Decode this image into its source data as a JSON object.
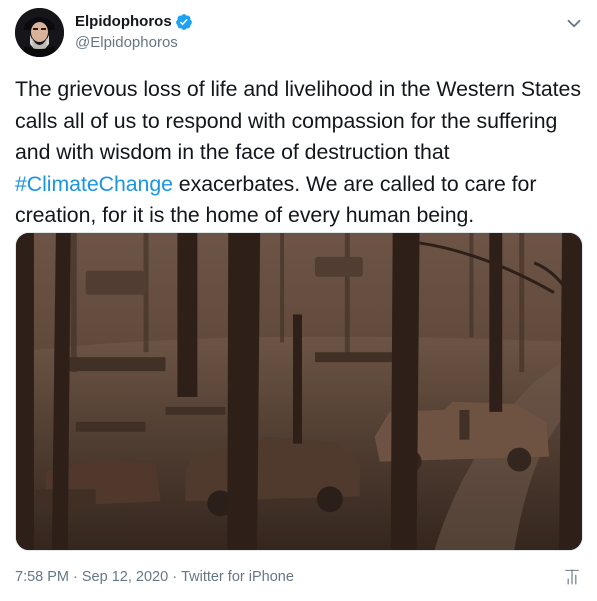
{
  "author": {
    "display_name": "Elpidophoros",
    "handle": "@Elpidophoros",
    "verified": true
  },
  "tweet": {
    "text_before": "The grievous loss of life and livelihood in the Western States calls all of us to respond with compassion for the suffering and with wisdom in the face of destruction that ",
    "hashtag": "#ClimateChange",
    "text_after": " exacerbates. We are called to care for creation, for it is the home of every human being."
  },
  "meta": {
    "time": "7:58 PM",
    "separator1": " · ",
    "date": "Sep 12, 2020",
    "separator2": " · ",
    "source": "Twitter for iPhone"
  },
  "icons": {
    "verified": "verified-badge-icon",
    "caret": "chevron-down-icon",
    "analytics": "analytics-icon"
  },
  "colors": {
    "accent": "#1b95e0",
    "text": "#14171a",
    "secondary": "#657786",
    "verified": "#1da1f2"
  }
}
